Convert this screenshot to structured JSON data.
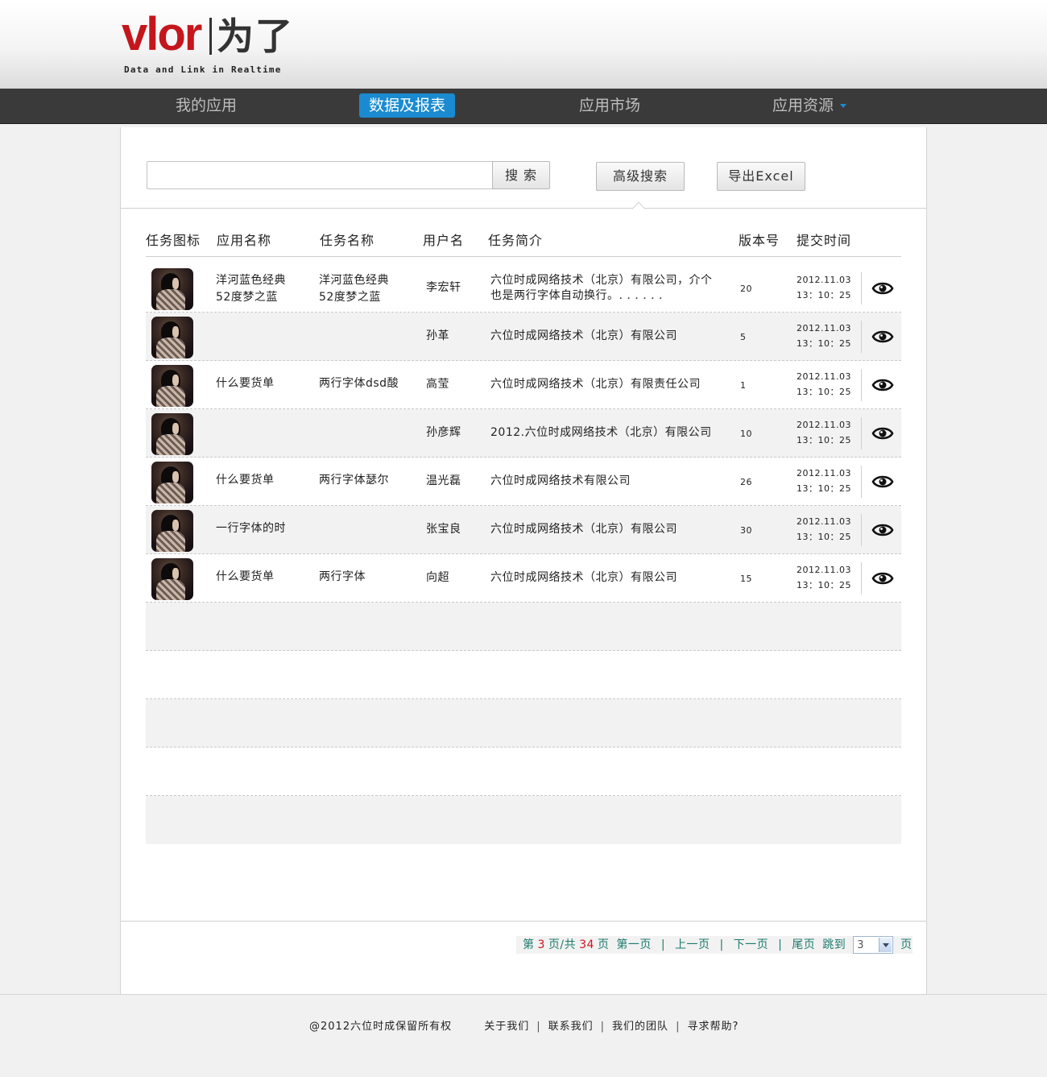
{
  "logo": {
    "word": "vlor",
    "cn": "为了",
    "tagline": "Data and Link in Realtime"
  },
  "nav": {
    "items": [
      {
        "label": "我的应用"
      },
      {
        "label": "数据及报表"
      },
      {
        "label": "应用市场"
      },
      {
        "label": "应用资源"
      }
    ],
    "active_index": 1
  },
  "search": {
    "value": "",
    "placeholder": "",
    "button_label": "搜 索"
  },
  "toolbar": {
    "advanced_search_label": "高级搜索",
    "export_label": "导出Excel"
  },
  "table": {
    "headers": [
      "任务图标",
      "应用名称",
      "任务名称",
      "用户名",
      "任务简介",
      "版本号",
      "提交时间"
    ],
    "rows": [
      {
        "app_name": [
          "洋河蓝色经典",
          "52度梦之蓝"
        ],
        "task_name": [
          "洋河蓝色经典",
          "52度梦之蓝"
        ],
        "user": "李宏轩",
        "intro": [
          "六位时成网络技术（北京）有限公司，介个",
          "也是两行字体自动换行。. . . . . ."
        ],
        "version": "20",
        "date": "2012.11.03",
        "time": "13：10：25"
      },
      {
        "app_name": [],
        "task_name": [],
        "user": "孙革",
        "intro": [
          "六位时成网络技术（北京）有限公司"
        ],
        "version": "5",
        "date": "2012.11.03",
        "time": "13：10：25"
      },
      {
        "app_name": [
          "什么要货单"
        ],
        "task_name": [
          "两行字体dsd酸"
        ],
        "user": "高莹",
        "intro": [
          "六位时成网络技术（北京）有限责任公司"
        ],
        "version": "1",
        "date": "2012.11.03",
        "time": "13：10：25"
      },
      {
        "app_name": [],
        "task_name": [],
        "user": "孙彦辉",
        "intro": [
          "2012.六位时成网络技术（北京）有限公司"
        ],
        "version": "10",
        "date": "2012.11.03",
        "time": "13：10：25"
      },
      {
        "app_name": [
          "什么要货单"
        ],
        "task_name": [
          "两行字体瑟尔"
        ],
        "user": "温光磊",
        "intro": [
          "六位时成网络技术有限公司"
        ],
        "version": "26",
        "date": "2012.11.03",
        "time": "13：10：25"
      },
      {
        "app_name": [
          "一行字体的时"
        ],
        "task_name": [],
        "user": "张宝良",
        "intro": [
          "六位时成网络技术（北京）有限公司"
        ],
        "version": "30",
        "date": "2012.11.03",
        "time": "13：10：25"
      },
      {
        "app_name": [
          "什么要货单"
        ],
        "task_name": [
          "两行字体"
        ],
        "user": "向超",
        "intro": [
          "六位时成网络技术（北京）有限公司"
        ],
        "version": "15",
        "date": "2012.11.03",
        "time": "13：10：25"
      }
    ],
    "empty_rows": 5
  },
  "pager": {
    "prefix": "第",
    "current": "3",
    "mid": "页/共",
    "total": "34",
    "suffix": "页",
    "first": "第一页",
    "prev": "上一页",
    "next": "下一页",
    "last": "尾页",
    "jump": "跳到",
    "jump_value": "3",
    "jump_suffix": "页"
  },
  "footer": {
    "copyright": "@2012六位时成保留所有权",
    "links": [
      "关于我们",
      "联系我们",
      "我们的团队",
      "寻求帮助?"
    ]
  },
  "colors": {
    "brand_red": "#c4161c",
    "nav_bg": "#3a3a3a",
    "nav_active": "#1a8bd1",
    "pager_text": "#1d7a6e",
    "pager_number": "#d0141c"
  },
  "icons": {
    "view": "eye-icon",
    "dropdown": "caret-down-icon"
  }
}
